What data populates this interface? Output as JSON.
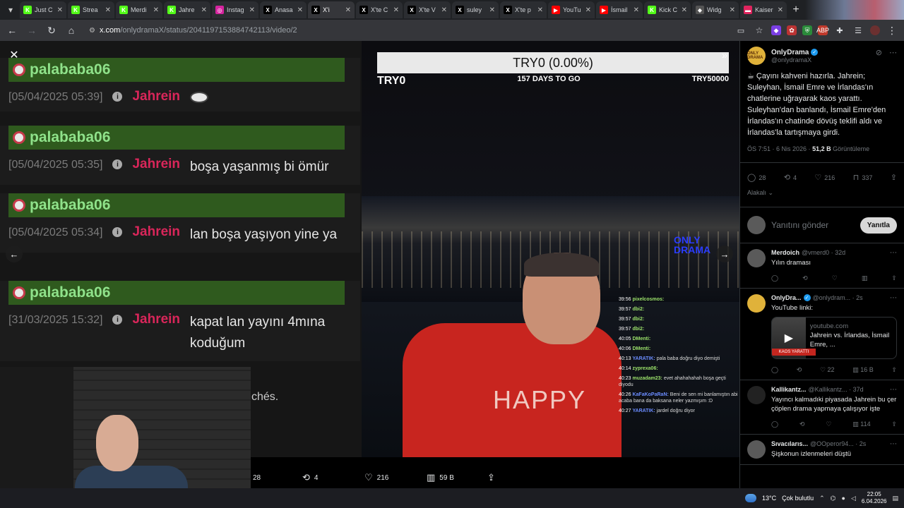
{
  "tabs": [
    {
      "label": "Just C",
      "color": "#53fc18",
      "glyph": "K"
    },
    {
      "label": "Strea",
      "color": "#53fc18",
      "glyph": "K"
    },
    {
      "label": "Merdi",
      "color": "#53fc18",
      "glyph": "K"
    },
    {
      "label": "Jahre",
      "color": "#53fc18",
      "glyph": "K"
    },
    {
      "label": "Instag",
      "color": "#d6249f",
      "glyph": "◎"
    },
    {
      "label": "Anasa",
      "color": "#000000",
      "glyph": "X"
    },
    {
      "label": "X'i",
      "color": "#000000",
      "glyph": "X"
    },
    {
      "label": "X'te C",
      "color": "#000000",
      "glyph": "X"
    },
    {
      "label": "X'te V",
      "color": "#000000",
      "glyph": "X"
    },
    {
      "label": "suley",
      "color": "#000000",
      "glyph": "X"
    },
    {
      "label": "X'te p",
      "color": "#000000",
      "glyph": "X"
    },
    {
      "label": "YouTu",
      "color": "#ff0000",
      "glyph": "▶"
    },
    {
      "label": "İsmail",
      "color": "#ff0000",
      "glyph": "▶"
    },
    {
      "label": "Kick C",
      "color": "#53fc18",
      "glyph": "K"
    },
    {
      "label": "Widg",
      "color": "#555555",
      "glyph": "◆"
    },
    {
      "label": "Kaiser",
      "color": "#e0245e",
      "glyph": "▬"
    }
  ],
  "address": {
    "site": "x.com",
    "path": "/onlydramaX/status/2041197153884742113/video/2"
  },
  "chatlog": {
    "entries": [
      {
        "user": "palababa06",
        "time": "[05/04/2025 05:39]",
        "author": "Jahrein",
        "text": "",
        "has_emote": true
      },
      {
        "user": "palababa06",
        "time": "[05/04/2025 05:35]",
        "author": "Jahrein",
        "text": "boşa yaşanmış bi ömür",
        "has_emote": false
      },
      {
        "user": "palababa06",
        "time": "[05/04/2025 05:34]",
        "author": "Jahrein",
        "text": "lan boşa yaşıyon yine ya",
        "has_emote": false
      },
      {
        "user": "palababa06",
        "time": "[31/03/2025 15:32]",
        "author": "Jahrein",
        "text": "kapat lan yayını 4mına koduğum",
        "has_emote": false
      }
    ],
    "partial_text": "chés."
  },
  "stream": {
    "goal_text": "TRY0 (0.00%)",
    "goal_left": "TRY0",
    "goal_mid": "157 DAYS TO GO",
    "goal_right": "TRY50000",
    "shirt_text": "HAPPY",
    "logo_text": "ONLY DRAMA",
    "overlay_chat": [
      {
        "time": "39:56",
        "name": "pixelcosmos:",
        "msg": ""
      },
      {
        "time": "39:57",
        "name": "dbi2:",
        "msg": ""
      },
      {
        "time": "39:57",
        "name": "dbi2:",
        "msg": ""
      },
      {
        "time": "39:57",
        "name": "dbi2:",
        "msg": ""
      },
      {
        "time": "40:05",
        "name": "DMenti:",
        "msg": ""
      },
      {
        "time": "40:06",
        "name": "DMenti:",
        "msg": ""
      },
      {
        "time": "40:13",
        "name": "YARATIK:",
        "msg": "pala baba doğru diyo demişti"
      },
      {
        "time": "40:14",
        "name": "zyprexa06:",
        "msg": ""
      },
      {
        "time": "40:23",
        "name": "muzadam23:",
        "msg": "evet ahahahahah boşa geçti diyodu"
      },
      {
        "time": "40:26",
        "name": "KaFaKoPaRaN:",
        "msg": "Beni de sen mi banlamıştın abi acaba bana da baksana neler yazmışım :D"
      },
      {
        "time": "40:27",
        "name": "YARATIK:",
        "msg": "jardel doğru diyor"
      }
    ]
  },
  "media_actions": {
    "replies": "28",
    "reposts": "4",
    "likes": "216",
    "views": "59 B"
  },
  "tweet": {
    "author": "OnlyDrama",
    "handle": "@onlydramaX",
    "avatar_text": "ONLY DRAMA",
    "text": "☕ Çayını kahveni hazırla. Jahrein; Suleyhan, İsmail Emre ve İrlandas'ın chatlerine uğrayarak kaos yarattı. Suleyhan'dan banlandı, İsmail Emre'den İrlandas'ın chatinde dövüş teklifi aldı ve İrlandas'la tartışmaya girdi.",
    "time": "ÖS 7:51 · 6 Nis 2026 ·",
    "views_count": "51,2 B",
    "views_label": "Görüntüleme",
    "stats": {
      "replies": "28",
      "reposts": "4",
      "likes": "216",
      "bookmarks": "337"
    },
    "related_label": "Alakalı",
    "reply_placeholder": "Yanıtını gönder",
    "reply_button": "Yanıtla"
  },
  "replies": [
    {
      "name": "Merdoich",
      "handle": "@vmerd0 · 32d",
      "text": "Yılın draması",
      "likes": "",
      "views": "",
      "verified": false
    },
    {
      "name": "OnlyDra...",
      "handle": "@onlydram... · 2s",
      "text": "YouTube linki:",
      "likes": "22",
      "views": "16 B",
      "verified": true,
      "card": {
        "domain": "youtube.com",
        "title": "Jahrein vs. İrlandas, İsmail Emre, ...",
        "thumb_band": "KAOS YARATTI"
      }
    },
    {
      "name": "Kallikantz...",
      "handle": "@Kallikantz... · 37d",
      "text": "Yayıncı kalmadıki piyasada Jahrein bu çer çöplen drama yapmaya çalışıyor işte",
      "likes": "",
      "views": "114",
      "verified": false
    },
    {
      "name": "Sıvacılarıs...",
      "handle": "@OOperor94... · 2s",
      "text": "Şişkonun izlenmeleri düştü",
      "likes": "",
      "views": "",
      "verified": false
    }
  ],
  "taskbar": {
    "temperature": "13°C",
    "weather": "Çok bulutlu",
    "time": "22:05",
    "date": "6.04.2026"
  },
  "colors": {
    "x_blue": "#1d9bf0",
    "jahrein_red": "#d9265a",
    "username_green": "#8fe28a"
  }
}
